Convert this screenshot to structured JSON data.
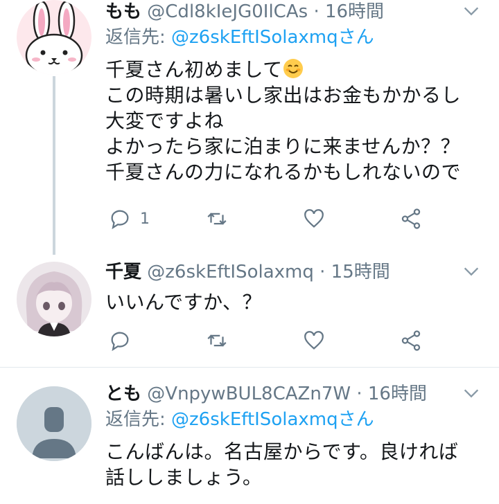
{
  "tweets": [
    {
      "name": "もも",
      "handle": "@Cdl8kIeJG0IlCAs",
      "time": "16時間",
      "reply_prefix": "返信先: ",
      "reply_to": "@z6skEftISolaxmq",
      "reply_suffix": "さん",
      "text_line1": "千夏さん初めまして",
      "text_rest": "この時期は暑いし家出はお金もかかるし\n大変ですよね\nよかったら家に泊まりに来ませんか？？\n千夏さんの力になれるかもしれないので",
      "reply_count": "1",
      "avatar": "bunny-avatar"
    },
    {
      "name": "千夏",
      "handle": "@z6skEftISolaxmq",
      "time": "15時間",
      "text": "いいんですか、？",
      "avatar": "anime-girl-avatar"
    },
    {
      "name": "とも",
      "handle": "@VnpywBUL8CAZn7W",
      "time": "16時間",
      "reply_prefix": "返信先: ",
      "reply_to": "@z6skEftISolaxmq",
      "reply_suffix": "さん",
      "text": "こんばんは。名古屋からです。良ければ\n話ししましょう。",
      "avatar": "default-avatar"
    }
  ],
  "colors": {
    "link": "#1da1f2",
    "muted": "#657786",
    "thread": "#ccd6dd"
  },
  "icons": [
    "reply-icon",
    "retweet-icon",
    "like-icon",
    "share-icon",
    "chevron-down-icon",
    "smiling-face-emoji"
  ]
}
